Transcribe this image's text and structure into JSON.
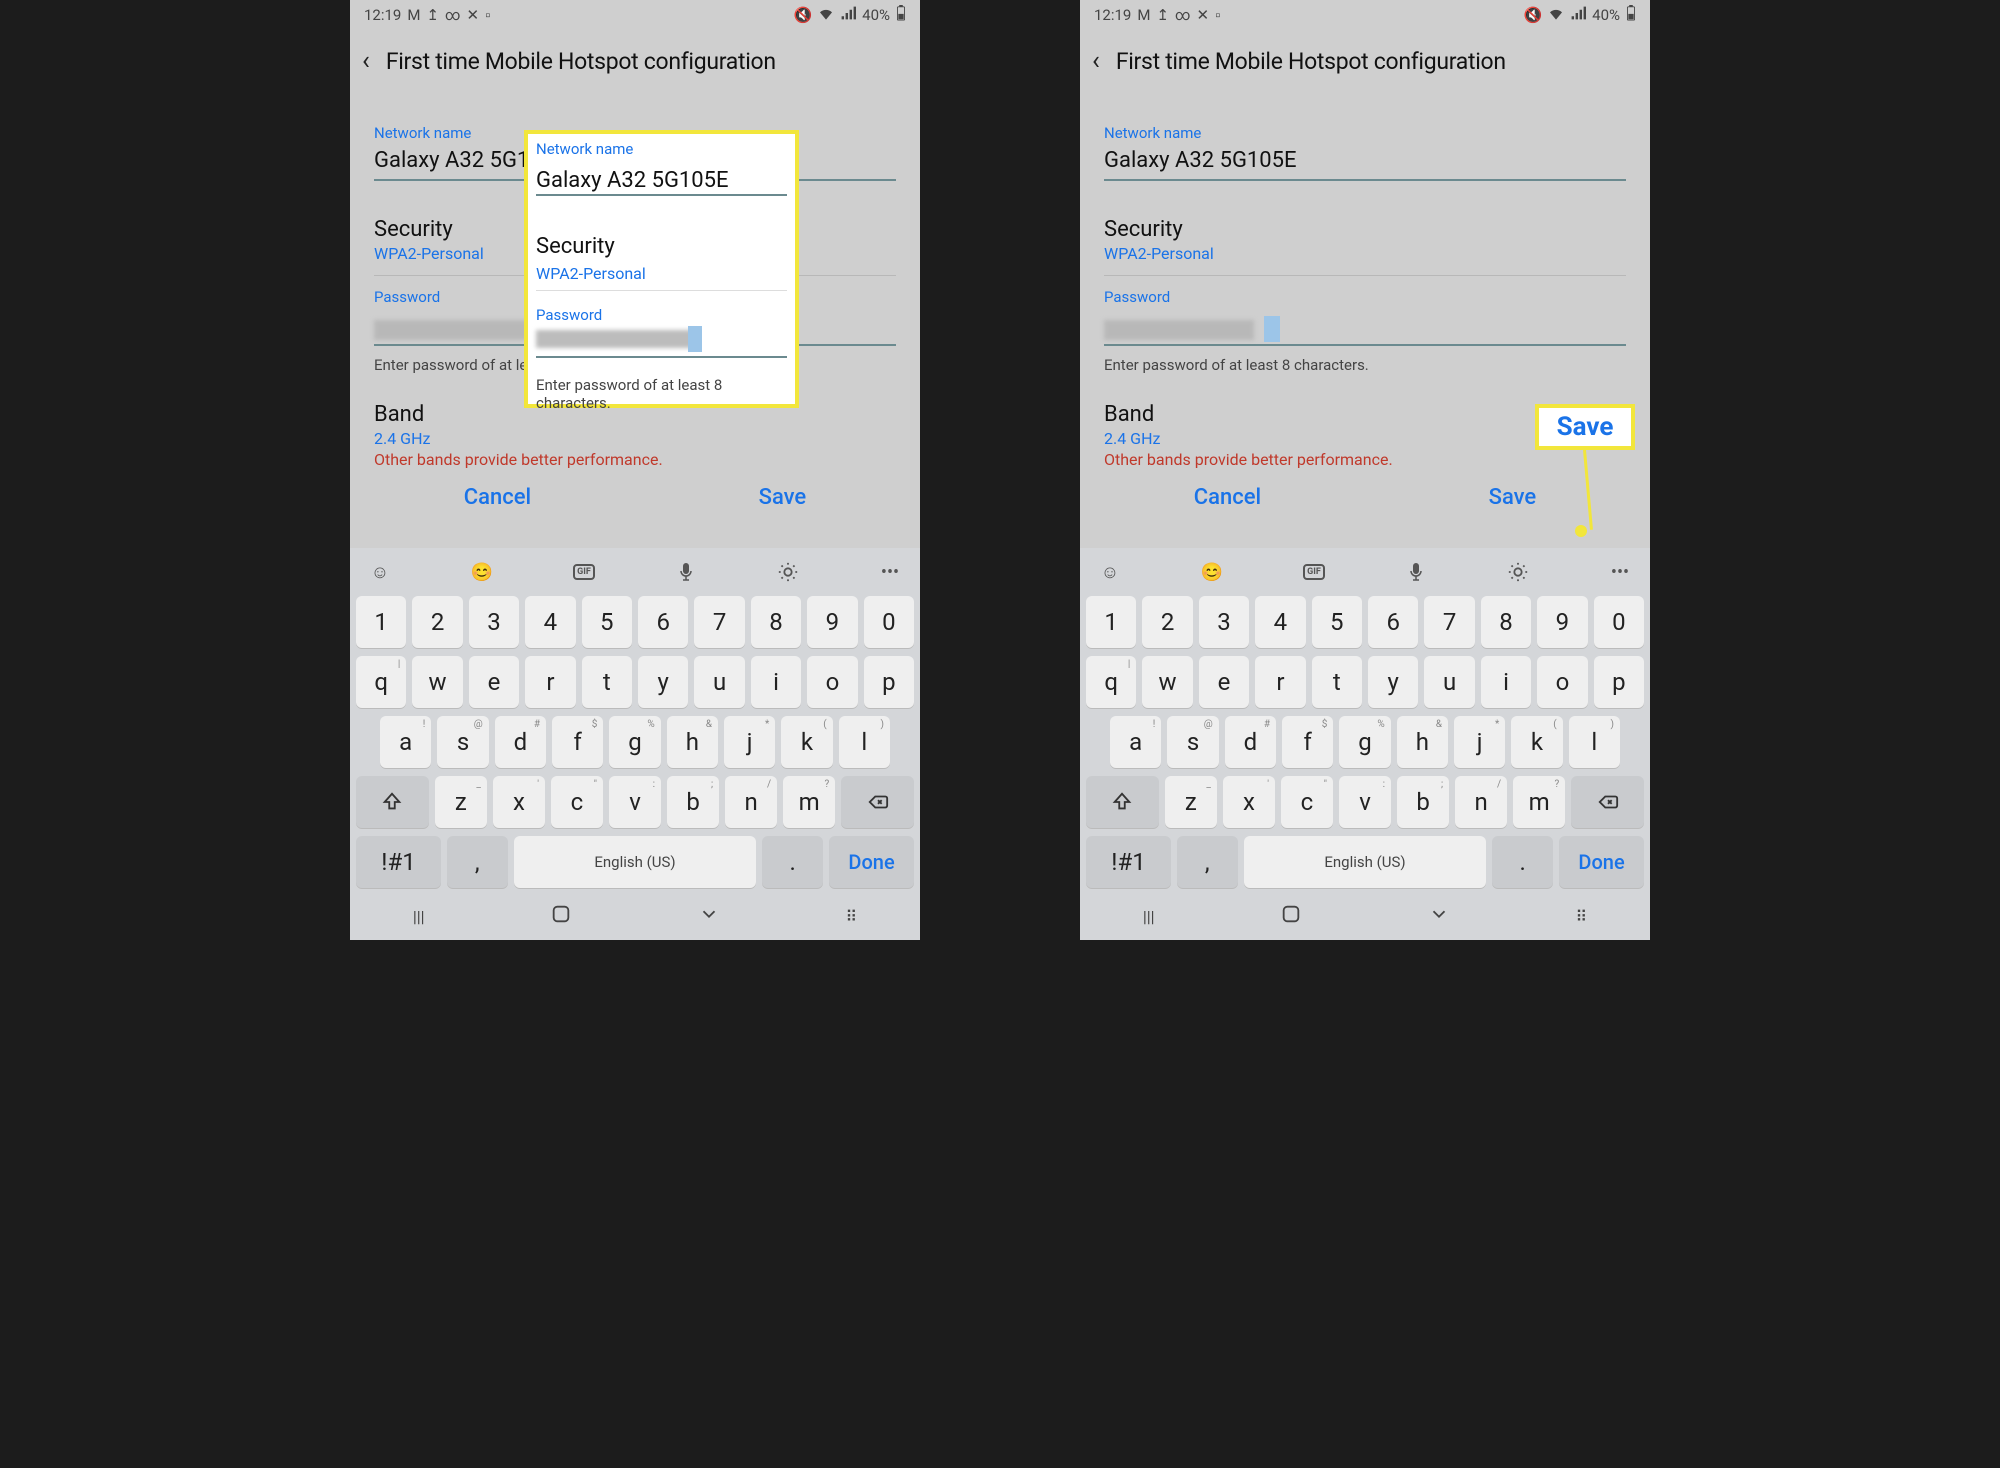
{
  "status": {
    "time": "12:19",
    "battery": "40%"
  },
  "header": {
    "title": "First time Mobile Hotspot configuration"
  },
  "form": {
    "network_label": "Network name",
    "network_value": "Galaxy A32 5G105E",
    "security_label": "Security",
    "security_value": "WPA2-Personal",
    "password_label": "Password",
    "password_helper": "Enter password of at least 8 characters.",
    "band_label": "Band",
    "band_value": "2.4 GHz",
    "band_warning": "Other bands provide better performance."
  },
  "buttons": {
    "cancel": "Cancel",
    "save": "Save"
  },
  "callout": {
    "save": "Save"
  },
  "keyboard": {
    "row1": [
      "1",
      "2",
      "3",
      "4",
      "5",
      "6",
      "7",
      "8",
      "9",
      "0"
    ],
    "row2": [
      {
        "k": "q",
        "s": "|"
      },
      {
        "k": "w",
        "s": ""
      },
      {
        "k": "e",
        "s": ""
      },
      {
        "k": "r",
        "s": ""
      },
      {
        "k": "t",
        "s": ""
      },
      {
        "k": "y",
        "s": ""
      },
      {
        "k": "u",
        "s": ""
      },
      {
        "k": "i",
        "s": ""
      },
      {
        "k": "o",
        "s": ""
      },
      {
        "k": "p",
        "s": ""
      }
    ],
    "row3": [
      {
        "k": "a",
        "s": "!"
      },
      {
        "k": "s",
        "s": "@"
      },
      {
        "k": "d",
        "s": "#"
      },
      {
        "k": "f",
        "s": "$"
      },
      {
        "k": "g",
        "s": "%"
      },
      {
        "k": "h",
        "s": "&"
      },
      {
        "k": "j",
        "s": "*"
      },
      {
        "k": "k",
        "s": "("
      },
      {
        "k": "l",
        "s": ")"
      }
    ],
    "row4": [
      {
        "k": "z",
        "s": "_"
      },
      {
        "k": "x",
        "s": "'"
      },
      {
        "k": "c",
        "s": "\""
      },
      {
        "k": "v",
        "s": ":"
      },
      {
        "k": "b",
        "s": ";"
      },
      {
        "k": "n",
        "s": "/"
      },
      {
        "k": "m",
        "s": "?"
      }
    ],
    "sym": "!#1",
    "space": "English (US)",
    "done": "Done"
  }
}
